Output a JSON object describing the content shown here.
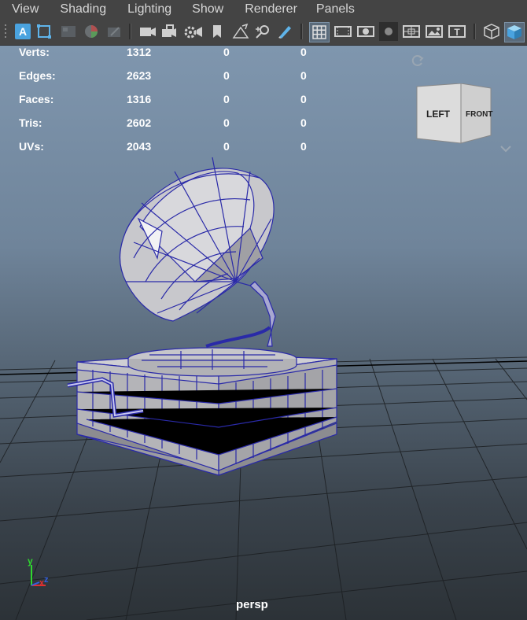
{
  "menu": [
    "View",
    "Shading",
    "Lighting",
    "Show",
    "Renderer",
    "Panels"
  ],
  "toolbar": {
    "icons": [
      "select-camera-icon",
      "camera-attributes-icon",
      "bookmarks-icon",
      "image-plane-icon",
      "2d-pan-zoom-icon",
      "camera-icon",
      "lock-camera-icon",
      "camera-settings-icon",
      "cam-bookmark-icon",
      "grease-pencil-icon",
      "grid-icon",
      "film-gate-icon",
      "resolution-gate-icon",
      "gate-mask-icon",
      "field-chart-icon",
      "safe-action-icon",
      "safe-title-icon",
      "wireframe-cube-icon",
      "smooth-shade-cube-icon"
    ]
  },
  "hud": {
    "rows": [
      {
        "label": "Verts:",
        "c1": "1312",
        "c2": "0",
        "c3": "0"
      },
      {
        "label": "Edges:",
        "c1": "2623",
        "c2": "0",
        "c3": "0"
      },
      {
        "label": "Faces:",
        "c1": "1316",
        "c2": "0",
        "c3": "0"
      },
      {
        "label": "Tris:",
        "c1": "2602",
        "c2": "0",
        "c3": "0"
      },
      {
        "label": "UVs:",
        "c1": "2043",
        "c2": "0",
        "c3": "0"
      }
    ]
  },
  "viewcube": {
    "left": "LEFT",
    "front": "FRONT"
  },
  "axis": {
    "y": "y",
    "x": "x",
    "z": "z"
  },
  "camera_label": "persp",
  "colors": {
    "accent": "#4aa3df",
    "wire": "#2a2aa8",
    "hud_text": "#ffffff"
  }
}
